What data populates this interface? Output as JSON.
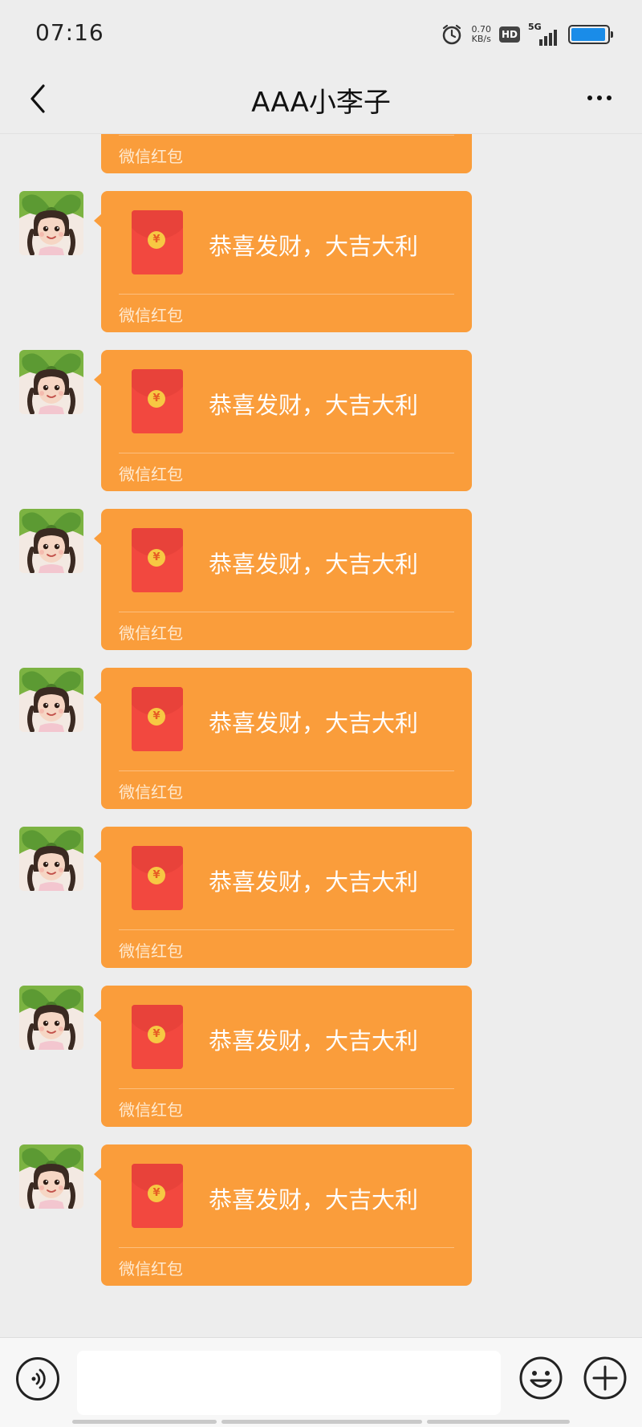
{
  "status_bar": {
    "time": "07:16",
    "net_speed_value": "0.70",
    "net_speed_unit": "KB/s",
    "hd_label": "HD",
    "network_label": "5G",
    "alarm_icon": "alarm-clock-icon",
    "battery_level": 0.95,
    "battery_color": "#1a8ce8"
  },
  "header": {
    "title": "AAA小李子",
    "back_icon": "chevron-left-icon",
    "more_icon": "more-dots-icon"
  },
  "messages": [
    {
      "type": "red_packet",
      "title": "",
      "footer": "微信红包",
      "partial": true
    },
    {
      "type": "red_packet",
      "title": "恭喜发财，大吉大利",
      "footer": "微信红包"
    },
    {
      "type": "red_packet",
      "title": "恭喜发财，大吉大利",
      "footer": "微信红包"
    },
    {
      "type": "red_packet",
      "title": "恭喜发财，大吉大利",
      "footer": "微信红包"
    },
    {
      "type": "red_packet",
      "title": "恭喜发财，大吉大利",
      "footer": "微信红包"
    },
    {
      "type": "red_packet",
      "title": "恭喜发财，大吉大利",
      "footer": "微信红包"
    },
    {
      "type": "red_packet",
      "title": "恭喜发财，大吉大利",
      "footer": "微信红包"
    },
    {
      "type": "red_packet",
      "title": "恭喜发财，大吉大利",
      "footer": "微信红包"
    }
  ],
  "input_bar": {
    "voice_icon": "voice-icon",
    "emoji_icon": "emoji-smile-icon",
    "plus_icon": "plus-circle-icon",
    "input_value": ""
  },
  "colors": {
    "background": "#ededed",
    "red_packet_bubble": "#fa9d3b",
    "envelope": "#f2483f",
    "coin": "#f7c843"
  }
}
